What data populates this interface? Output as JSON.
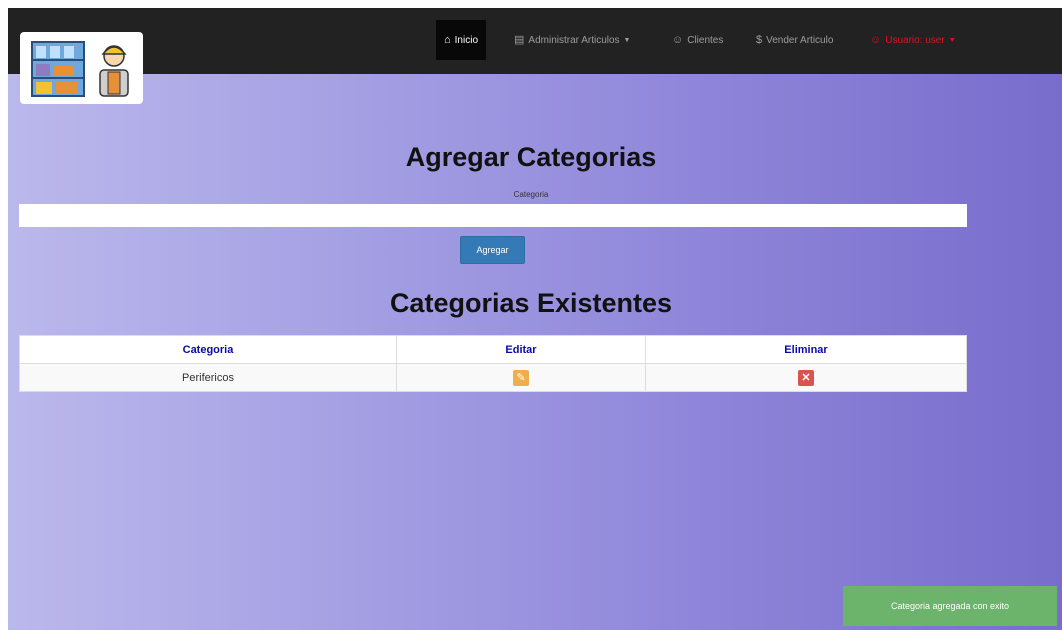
{
  "nav": {
    "items": [
      {
        "icon": "home-icon",
        "glyph": "⌂",
        "label": "Inicio"
      },
      {
        "icon": "list-icon",
        "glyph": "▤",
        "label": "Administrar Articulos"
      },
      {
        "icon": "user-icon",
        "glyph": "☺",
        "label": "Clientes"
      },
      {
        "icon": "dollar-icon",
        "glyph": "$",
        "label": "Vender Articulo"
      },
      {
        "icon": "user-icon",
        "glyph": "☺",
        "label": "Usuario: user"
      }
    ],
    "user_color": "#e0141b"
  },
  "form": {
    "title": "Agregar Categorias",
    "field_label": "Categoria",
    "input_value": "",
    "button_label": "Agregar"
  },
  "table": {
    "title": "Categorias Existentes",
    "headers": [
      "Categoria",
      "Editar",
      "Eliminar"
    ],
    "rows": [
      {
        "categoria": "Perifericos"
      }
    ],
    "header_color": "#0a0aa6"
  },
  "toast": {
    "message": "Categoria agregada con exito",
    "color": "#6cb36b"
  }
}
